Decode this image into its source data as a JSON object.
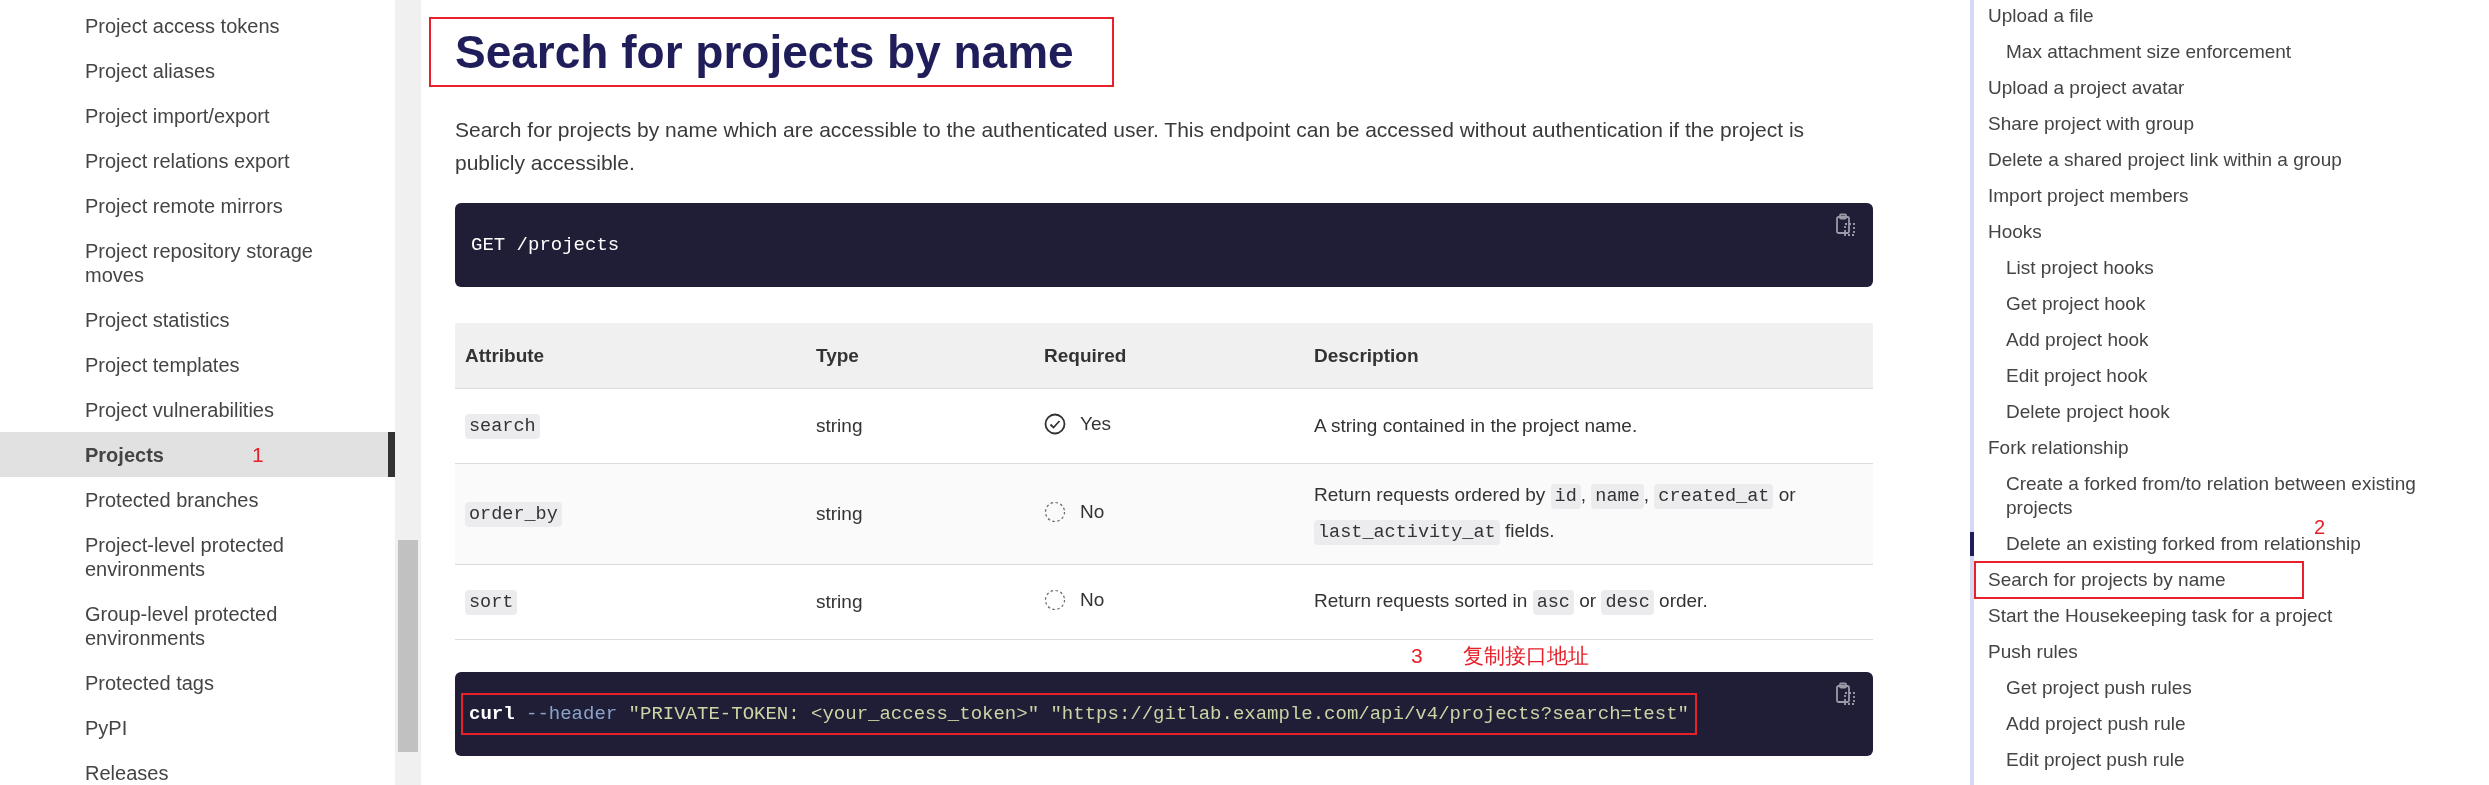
{
  "sidebar": {
    "items": [
      {
        "label": "Project access tokens",
        "selected": false
      },
      {
        "label": "Project aliases",
        "selected": false
      },
      {
        "label": "Project import/export",
        "selected": false
      },
      {
        "label": "Project relations export",
        "selected": false
      },
      {
        "label": "Project remote mirrors",
        "selected": false
      },
      {
        "label": "Project repository storage moves",
        "selected": false
      },
      {
        "label": "Project statistics",
        "selected": false
      },
      {
        "label": "Project templates",
        "selected": false
      },
      {
        "label": "Project vulnerabilities",
        "selected": false
      },
      {
        "label": "Projects",
        "selected": true,
        "note": "1"
      },
      {
        "label": "Protected branches",
        "selected": false
      },
      {
        "label": "Project-level protected environments",
        "selected": false
      },
      {
        "label": "Group-level protected environments",
        "selected": false
      },
      {
        "label": "Protected tags",
        "selected": false
      },
      {
        "label": "PyPI",
        "selected": false
      },
      {
        "label": "Releases",
        "selected": false
      }
    ]
  },
  "content": {
    "heading": {
      "text": "Search for projects by name",
      "boxed": true
    },
    "intro": "Search for projects by name which are accessible to the authenticated user. This endpoint can be accessed without authentication if the project is publicly accessible.",
    "endpoint": "GET /projects",
    "table": {
      "columns": [
        "Attribute",
        "Type",
        "Required",
        "Description"
      ],
      "rows": [
        {
          "attribute": "search",
          "type": "string",
          "required": true,
          "required_text": "Yes",
          "description": [
            {
              "text": "A string contained in the project name.",
              "code": false
            }
          ]
        },
        {
          "attribute": "order_by",
          "type": "string",
          "required": false,
          "required_text": "No",
          "description": [
            {
              "text": "Return requests ordered by ",
              "code": false
            },
            {
              "text": "id",
              "code": true
            },
            {
              "text": ", ",
              "code": false
            },
            {
              "text": "name",
              "code": true
            },
            {
              "text": ", ",
              "code": false
            },
            {
              "text": "created_at",
              "code": true
            },
            {
              "text": " or ",
              "code": false
            },
            {
              "text": "last_activity_at",
              "code": true
            },
            {
              "text": " fields.",
              "code": false
            }
          ]
        },
        {
          "attribute": "sort",
          "type": "string",
          "required": false,
          "required_text": "No",
          "description": [
            {
              "text": "Return requests sorted in ",
              "code": false
            },
            {
              "text": "asc",
              "code": true
            },
            {
              "text": " or ",
              "code": false
            },
            {
              "text": "desc",
              "code": true
            },
            {
              "text": " order.",
              "code": false
            }
          ]
        }
      ]
    },
    "notes": [
      "3",
      "复制接口地址"
    ],
    "example": {
      "boxed": true,
      "tokens": [
        {
          "text": "curl",
          "kind": "command"
        },
        {
          "text": "--header",
          "kind": "flag"
        },
        {
          "text": "\"PRIVATE-TOKEN: <your_access_token>\"",
          "kind": "string"
        },
        {
          "text": "\"https://gitlab.example.com/api/v4/projects?search=test\"",
          "kind": "string"
        }
      ]
    }
  },
  "toc": {
    "items": [
      {
        "label": "Upload a file",
        "selected": false,
        "boxed": false,
        "children": [
          {
            "label": "Max attachment size enforcement",
            "selected": false,
            "boxed": false
          }
        ]
      },
      {
        "label": "Upload a project avatar",
        "selected": false,
        "boxed": false
      },
      {
        "label": "Share project with group",
        "selected": false,
        "boxed": false
      },
      {
        "label": "Delete a shared project link within a group",
        "selected": false,
        "boxed": false
      },
      {
        "label": "Import project members",
        "selected": false,
        "boxed": false
      },
      {
        "label": "Hooks",
        "selected": false,
        "boxed": false,
        "children": [
          {
            "label": "List project hooks",
            "selected": false,
            "boxed": false
          },
          {
            "label": "Get project hook",
            "selected": false,
            "boxed": false
          },
          {
            "label": "Add project hook",
            "selected": false,
            "boxed": false
          },
          {
            "label": "Edit project hook",
            "selected": false,
            "boxed": false
          },
          {
            "label": "Delete project hook",
            "selected": false,
            "boxed": false
          }
        ]
      },
      {
        "label": "Fork relationship",
        "selected": false,
        "boxed": false,
        "children": [
          {
            "label": "Create a forked from/to relation between existing projects",
            "selected": false,
            "boxed": false
          },
          {
            "label": "Delete an existing forked from relationship",
            "selected": true,
            "boxed": false,
            "note": "2"
          }
        ]
      },
      {
        "label": "Search for projects by name",
        "selected": false,
        "boxed": true
      },
      {
        "label": "Start the Housekeeping task for a project",
        "selected": false,
        "boxed": false
      },
      {
        "label": "Push rules",
        "selected": false,
        "boxed": false,
        "children": [
          {
            "label": "Get project push rules",
            "selected": false,
            "boxed": false
          },
          {
            "label": "Add project push rule",
            "selected": false,
            "boxed": false
          },
          {
            "label": "Edit project push rule",
            "selected": false,
            "boxed": false
          }
        ]
      }
    ]
  }
}
